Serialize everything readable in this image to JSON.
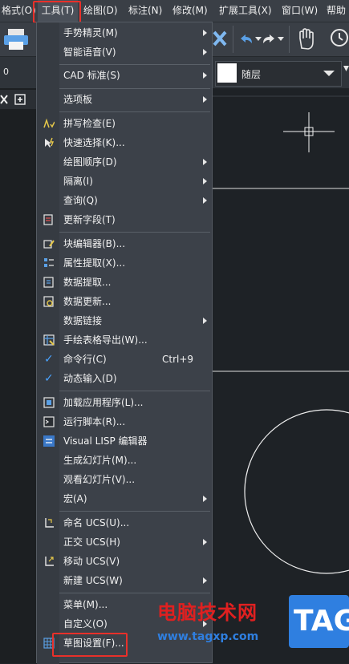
{
  "menubar": {
    "items": [
      "格式(O)",
      "工具(T)",
      "绘图(D)",
      "标注(N)",
      "修改(M)",
      "扩展工具(X)",
      "窗口(W)",
      "帮助"
    ]
  },
  "toolbar": {
    "layer_value": "随层",
    "left_value": "0"
  },
  "tools_menu": {
    "items": [
      {
        "label": "手势精灵(M)",
        "shortcut": "",
        "submenu": true
      },
      {
        "label": "智能语音(V)",
        "shortcut": "",
        "submenu": true
      },
      {
        "label": "CAD 标准(S)",
        "shortcut": "",
        "submenu": true
      },
      {
        "label": "选项板",
        "shortcut": "",
        "submenu": true
      },
      {
        "label": "拼写检查(E)",
        "shortcut": "",
        "submenu": false
      },
      {
        "label": "快速选择(K)...",
        "shortcut": "",
        "submenu": false
      },
      {
        "label": "绘图顺序(D)",
        "shortcut": "",
        "submenu": true
      },
      {
        "label": "隔离(I)",
        "shortcut": "",
        "submenu": true
      },
      {
        "label": "查询(Q)",
        "shortcut": "",
        "submenu": true
      },
      {
        "label": "更新字段(T)",
        "shortcut": "",
        "submenu": false
      },
      {
        "label": "块编辑器(B)...",
        "shortcut": "",
        "submenu": false
      },
      {
        "label": "属性提取(X)...",
        "shortcut": "",
        "submenu": false
      },
      {
        "label": "数据提取...",
        "shortcut": "",
        "submenu": false
      },
      {
        "label": "数据更新...",
        "shortcut": "",
        "submenu": false
      },
      {
        "label": "数据链接",
        "shortcut": "",
        "submenu": true
      },
      {
        "label": "手绘表格导出(W)...",
        "shortcut": "",
        "submenu": false
      },
      {
        "label": "命令行(C)",
        "shortcut": "Ctrl+9",
        "submenu": false
      },
      {
        "label": "动态输入(D)",
        "shortcut": "",
        "submenu": false
      },
      {
        "label": "加载应用程序(L)...",
        "shortcut": "",
        "submenu": false
      },
      {
        "label": "运行脚本(R)...",
        "shortcut": "",
        "submenu": false
      },
      {
        "label": "Visual LISP 编辑器",
        "shortcut": "",
        "submenu": false
      },
      {
        "label": "生成幻灯片(M)...",
        "shortcut": "",
        "submenu": false
      },
      {
        "label": "观看幻灯片(V)...",
        "shortcut": "",
        "submenu": false
      },
      {
        "label": "宏(A)",
        "shortcut": "",
        "submenu": true
      },
      {
        "label": "命名 UCS(U)...",
        "shortcut": "",
        "submenu": false
      },
      {
        "label": "正交 UCS(H)",
        "shortcut": "",
        "submenu": true
      },
      {
        "label": "移动 UCS(V)",
        "shortcut": "",
        "submenu": false
      },
      {
        "label": "新建 UCS(W)",
        "shortcut": "",
        "submenu": true
      },
      {
        "label": "菜单(M)...",
        "shortcut": "",
        "submenu": false
      },
      {
        "label": "自定义(O)",
        "shortcut": "",
        "submenu": true
      },
      {
        "label": "草图设置(F)...",
        "shortcut": "",
        "submenu": false
      }
    ]
  },
  "watermark": {
    "title": "电脑技术网",
    "url": "www.tagxp.com",
    "badge": "TAG"
  },
  "colors": {
    "highlight": "#e8302a",
    "accent": "#4aa3ff"
  }
}
